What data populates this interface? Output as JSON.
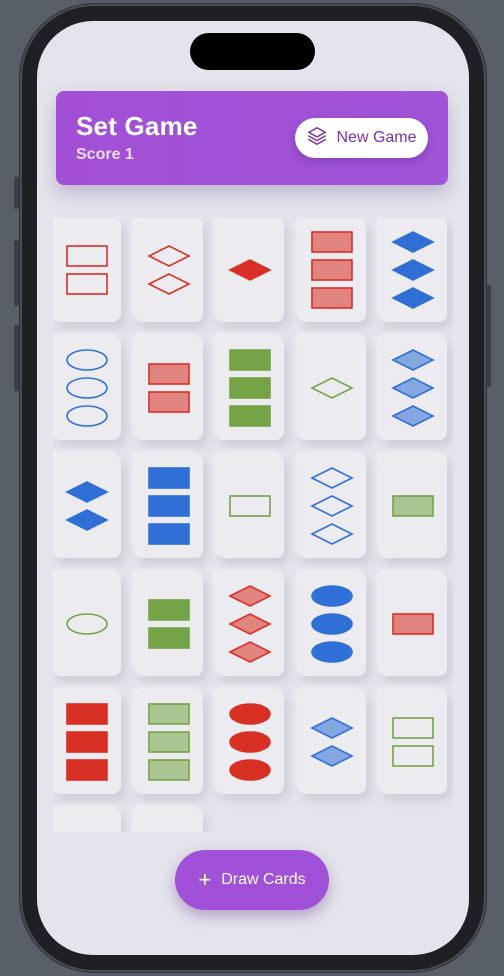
{
  "header": {
    "title": "Set Game",
    "score": "Score 1",
    "new_game_label": "New Game",
    "new_game_icon": "stack-icon"
  },
  "colors": {
    "accent": "#a24fd6",
    "red": "#d93025",
    "blue": "#2f6fd6",
    "green": "#74a445",
    "background": "#e4e4ec",
    "card": "#ebebf0"
  },
  "cards": [
    {
      "count": 2,
      "shape": "rectangle",
      "color": "red",
      "shading": "open"
    },
    {
      "count": 2,
      "shape": "diamond",
      "color": "red",
      "shading": "open"
    },
    {
      "count": 1,
      "shape": "diamond",
      "color": "red",
      "shading": "solid"
    },
    {
      "count": 3,
      "shape": "rectangle",
      "color": "red",
      "shading": "striped"
    },
    {
      "count": 3,
      "shape": "diamond",
      "color": "blue",
      "shading": "solid"
    },
    {
      "count": 3,
      "shape": "oval",
      "color": "blue",
      "shading": "open"
    },
    {
      "count": 2,
      "shape": "rectangle",
      "color": "red",
      "shading": "striped"
    },
    {
      "count": 3,
      "shape": "rectangle",
      "color": "green",
      "shading": "solid"
    },
    {
      "count": 1,
      "shape": "diamond",
      "color": "green",
      "shading": "open"
    },
    {
      "count": 3,
      "shape": "diamond",
      "color": "blue",
      "shading": "striped"
    },
    {
      "count": 2,
      "shape": "diamond",
      "color": "blue",
      "shading": "solid"
    },
    {
      "count": 3,
      "shape": "rectangle",
      "color": "blue",
      "shading": "solid"
    },
    {
      "count": 1,
      "shape": "rectangle",
      "color": "green",
      "shading": "open"
    },
    {
      "count": 3,
      "shape": "diamond",
      "color": "blue",
      "shading": "open"
    },
    {
      "count": 1,
      "shape": "rectangle",
      "color": "green",
      "shading": "striped"
    },
    {
      "count": 1,
      "shape": "oval",
      "color": "green",
      "shading": "open"
    },
    {
      "count": 2,
      "shape": "rectangle",
      "color": "green",
      "shading": "solid"
    },
    {
      "count": 3,
      "shape": "diamond",
      "color": "red",
      "shading": "striped"
    },
    {
      "count": 3,
      "shape": "oval",
      "color": "blue",
      "shading": "solid"
    },
    {
      "count": 1,
      "shape": "rectangle",
      "color": "red",
      "shading": "striped"
    },
    {
      "count": 3,
      "shape": "rectangle",
      "color": "red",
      "shading": "solid"
    },
    {
      "count": 3,
      "shape": "rectangle",
      "color": "green",
      "shading": "striped"
    },
    {
      "count": 3,
      "shape": "oval",
      "color": "red",
      "shading": "solid"
    },
    {
      "count": 2,
      "shape": "diamond",
      "color": "blue",
      "shading": "striped"
    },
    {
      "count": 2,
      "shape": "rectangle",
      "color": "green",
      "shading": "open"
    },
    {
      "count": 0,
      "shape": "none",
      "color": "none",
      "shading": "none"
    },
    {
      "count": 0,
      "shape": "none",
      "color": "none",
      "shading": "none"
    }
  ],
  "draw_button": {
    "label": "Draw Cards",
    "icon": "plus-icon"
  }
}
